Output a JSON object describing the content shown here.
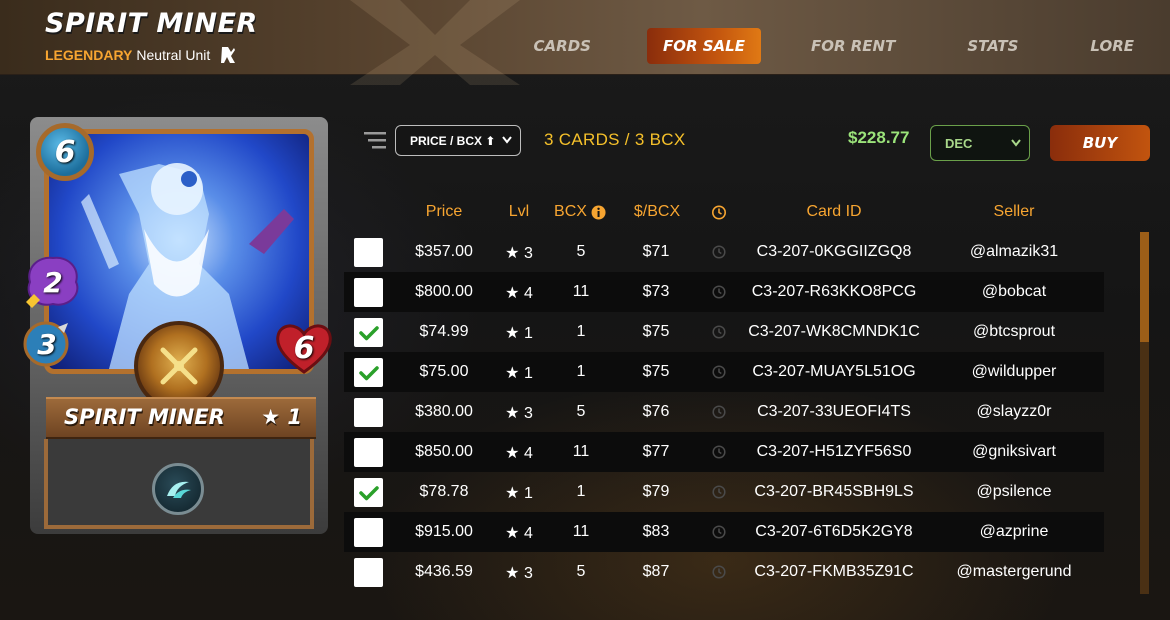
{
  "header": {
    "title": "SPIRIT MINER",
    "rarity": "LEGENDARY",
    "unit_type": "Neutral Unit",
    "nav": [
      {
        "label": "CARDS",
        "active": false
      },
      {
        "label": "FOR SALE",
        "active": true
      },
      {
        "label": "FOR RENT",
        "active": false
      },
      {
        "label": "STATS",
        "active": false
      },
      {
        "label": "LORE",
        "active": false
      }
    ]
  },
  "card": {
    "name": "SPIRIT MINER",
    "level": "★ 1",
    "mana": "6",
    "magic": "2",
    "speed": "3",
    "health": "6"
  },
  "toolbar": {
    "sort_label": "PRICE / BCX ⬆",
    "count_text": "3 CARDS / 3 BCX",
    "total": "$228.77",
    "currency": "DEC",
    "buy_label": "BUY"
  },
  "table": {
    "columns": [
      "Price",
      "Lvl",
      "BCX",
      "$/BCX",
      "",
      "Card ID",
      "Seller"
    ],
    "rows": [
      {
        "checked": false,
        "price": "$357.00",
        "lvl": "★ 3",
        "bcx": "5",
        "per_bcx": "$71",
        "card_id": "C3-207-0KGGIIZGQ8",
        "seller": "@almazik31"
      },
      {
        "checked": false,
        "price": "$800.00",
        "lvl": "★ 4",
        "bcx": "11",
        "per_bcx": "$73",
        "card_id": "C3-207-R63KKO8PCG",
        "seller": "@bobcat"
      },
      {
        "checked": true,
        "price": "$74.99",
        "lvl": "★ 1",
        "bcx": "1",
        "per_bcx": "$75",
        "card_id": "C3-207-WK8CMNDK1C",
        "seller": "@btcsprout"
      },
      {
        "checked": true,
        "price": "$75.00",
        "lvl": "★ 1",
        "bcx": "1",
        "per_bcx": "$75",
        "card_id": "C3-207-MUAY5L51OG",
        "seller": "@wildupper"
      },
      {
        "checked": false,
        "price": "$380.00",
        "lvl": "★ 3",
        "bcx": "5",
        "per_bcx": "$76",
        "card_id": "C3-207-33UEOFI4TS",
        "seller": "@slayzz0r"
      },
      {
        "checked": false,
        "price": "$850.00",
        "lvl": "★ 4",
        "bcx": "11",
        "per_bcx": "$77",
        "card_id": "C3-207-H51ZYF56S0",
        "seller": "@gniksivart"
      },
      {
        "checked": true,
        "price": "$78.78",
        "lvl": "★ 1",
        "bcx": "1",
        "per_bcx": "$79",
        "card_id": "C3-207-BR45SBH9LS",
        "seller": "@psilence"
      },
      {
        "checked": false,
        "price": "$915.00",
        "lvl": "★ 4",
        "bcx": "11",
        "per_bcx": "$83",
        "card_id": "C3-207-6T6D5K2GY8",
        "seller": "@azprine"
      },
      {
        "checked": false,
        "price": "$436.59",
        "lvl": "★ 3",
        "bcx": "5",
        "per_bcx": "$87",
        "card_id": "C3-207-FKMB35Z91C",
        "seller": "@mastergerund"
      }
    ]
  },
  "colors": {
    "accent_orange": "#f7a531",
    "count_yellow": "#f5c02a",
    "total_green": "#9be37a",
    "buy_button": "#c2540e"
  },
  "icons": [
    "filter-icon",
    "chevron-down-icon",
    "info-icon",
    "clock-icon",
    "checkmark-icon",
    "unit-type-icon",
    "ability-icon"
  ]
}
